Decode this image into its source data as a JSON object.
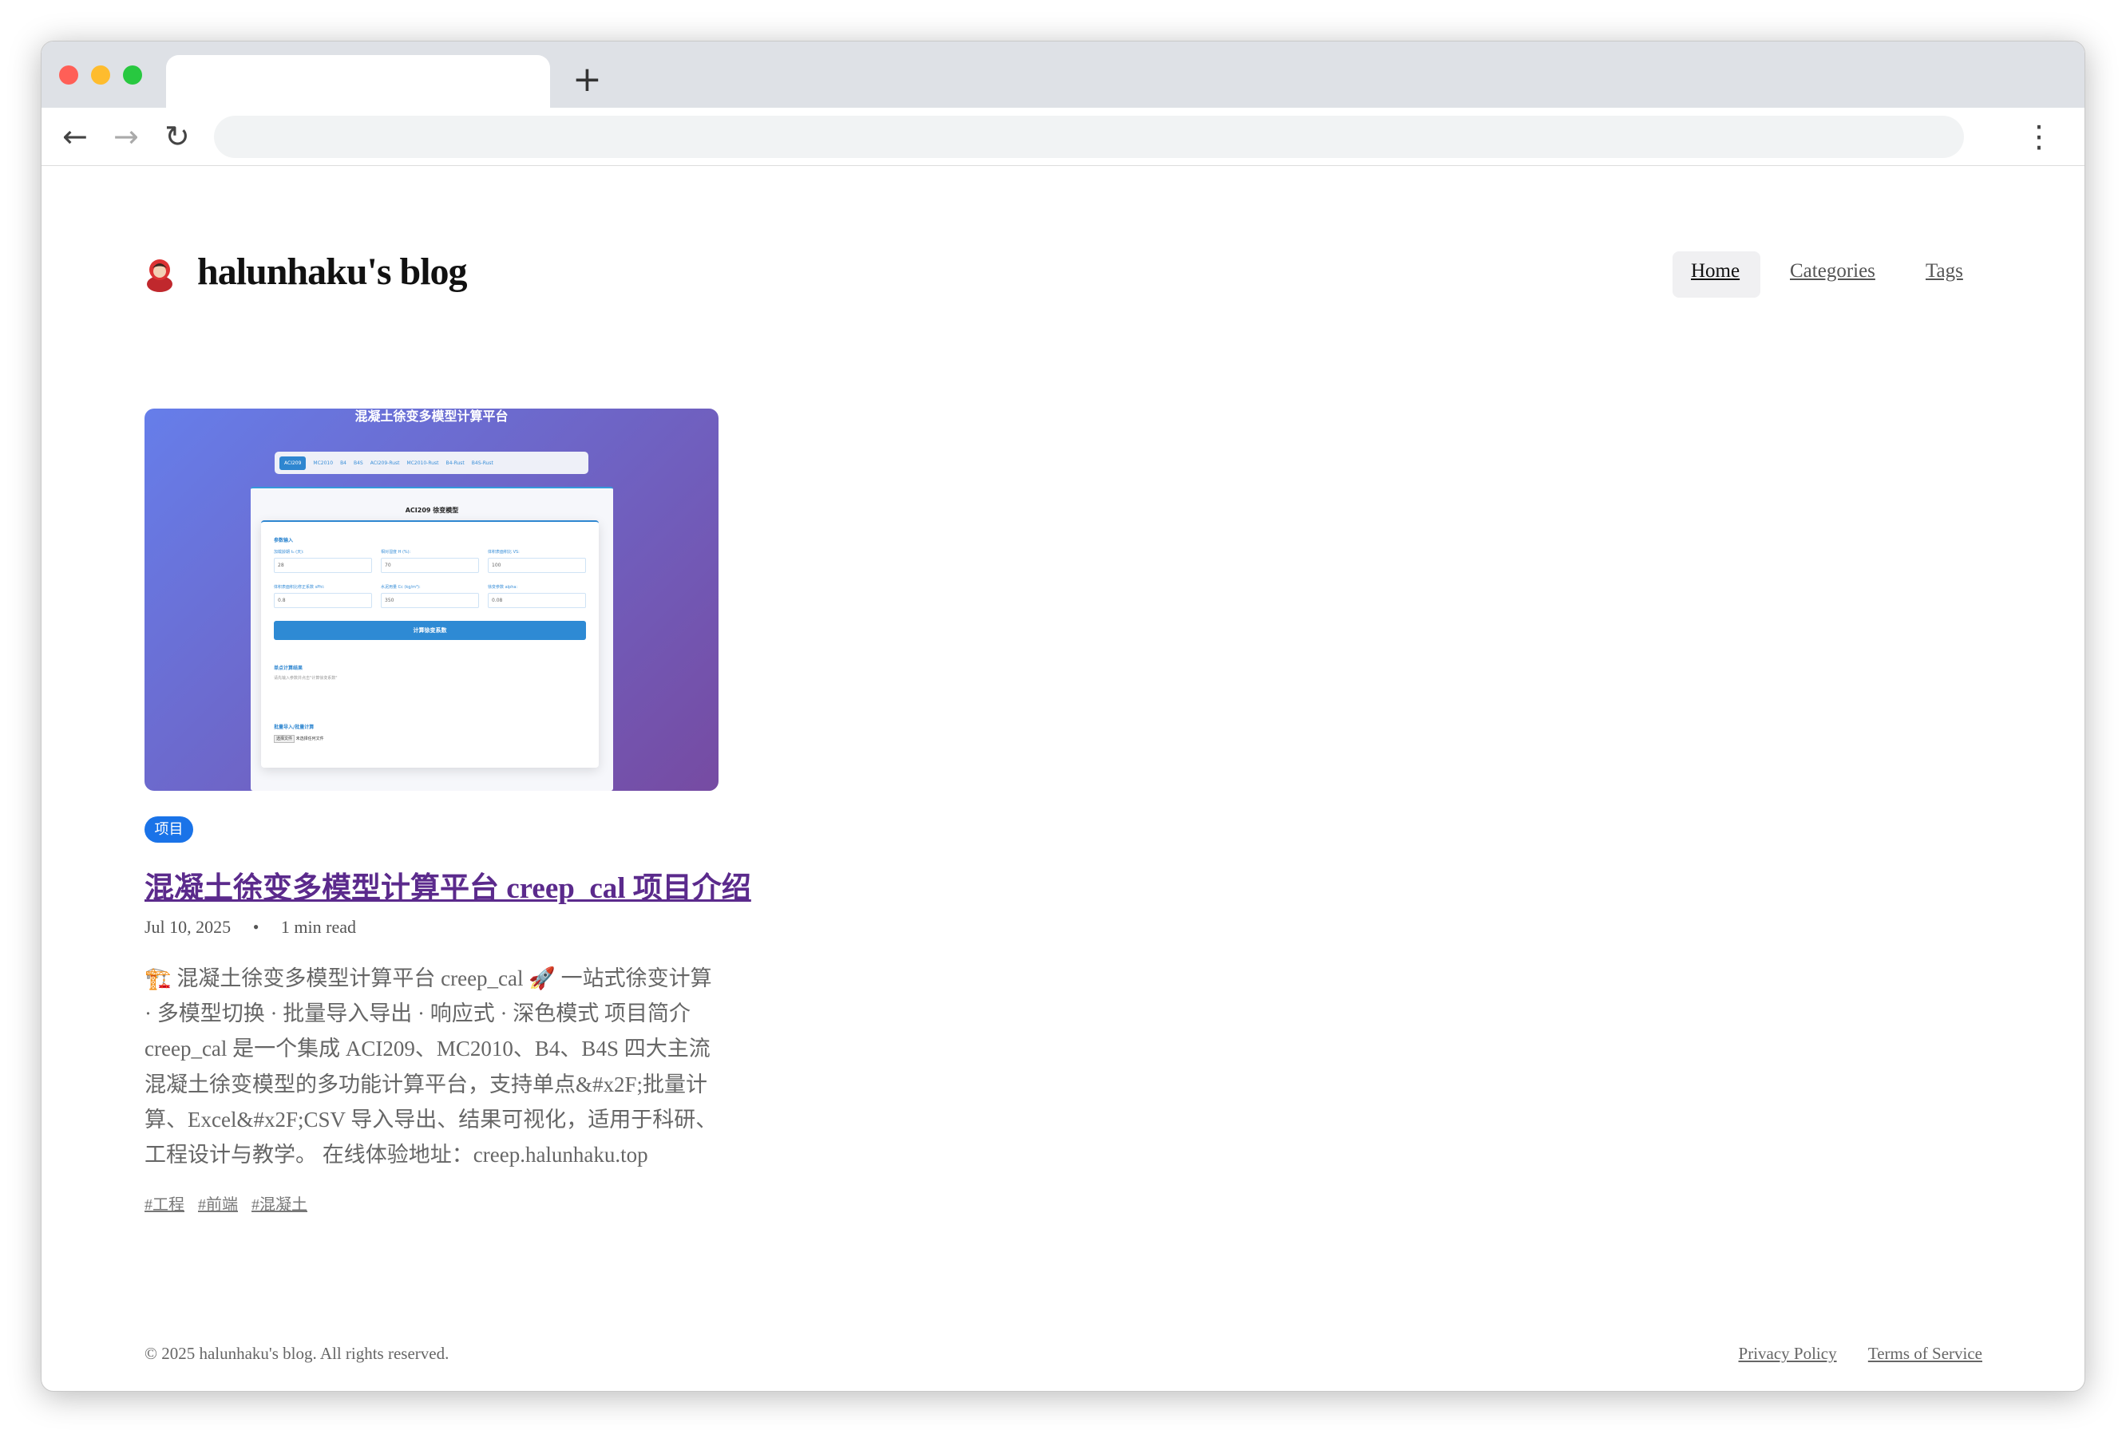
{
  "browser": {
    "new_tab": "+",
    "back": "←",
    "forward": "→",
    "reload": "↻",
    "menu": "⋮"
  },
  "site": {
    "brand": "halunhaku's blog",
    "nav": [
      "Home",
      "Categories",
      "Tags"
    ]
  },
  "thumbnail": {
    "title": "混凝土徐变多模型计算平台",
    "tabs": [
      "ACI209",
      "MC2010",
      "B4",
      "B4S",
      "ACI209-Rust",
      "MC2010-Rust",
      "B4-Rust",
      "B4S-Rust"
    ],
    "model_title": "ACI209 徐变模型",
    "section_input": "参数输入",
    "fields": [
      {
        "label": "加载龄期 t₀ (天):",
        "value": "28"
      },
      {
        "label": "相对湿度 H (%):",
        "value": "70"
      },
      {
        "label": "体积表面积比 VS:",
        "value": "100"
      },
      {
        "label": "体积表面积比修正系数 sPhi:",
        "value": "0.8"
      },
      {
        "label": "水泥用量 Cc (kg/m³):",
        "value": "350"
      },
      {
        "label": "徐变参数 alpha:",
        "value": "0.08"
      }
    ],
    "calc_button": "计算徐变系数",
    "section_result": "单点计算结果",
    "result_hint": "请先输入参数并点击\"计算徐变系数\"",
    "section_batch": "批量导入/批量计算",
    "file_button": "选择文件",
    "file_status": "未选择任何文件"
  },
  "post": {
    "category": "项目",
    "title": "混凝土徐变多模型计算平台 creep_cal 项目介绍",
    "date": "Jul 10, 2025",
    "separator": "•",
    "read_time": "1 min read",
    "excerpt": "🏗️ 混凝土徐变多模型计算平台 creep_cal 🚀 一站式徐变计算 · 多模型切换 · 批量导入导出 · 响应式 · 深色模式 项目简介 creep_cal 是一个集成 ACI209、MC2010、B4、B4S 四大主流混凝土徐变模型的多功能计算平台，支持单点&#x2F;批量计算、Excel&#x2F;CSV 导入导出、结果可视化，适用于科研、工程设计与教学。 在线体验地址：creep.halunhaku.top",
    "tags": [
      "#工程",
      "#前端",
      "#混凝土"
    ]
  },
  "footer": {
    "copyright": "© 2025 halunhaku's blog. All rights reserved.",
    "links": [
      "Privacy Policy",
      "Terms of Service"
    ]
  },
  "colors": {
    "accent": "#1a73e8",
    "visited_link": "#5b2a8c"
  }
}
